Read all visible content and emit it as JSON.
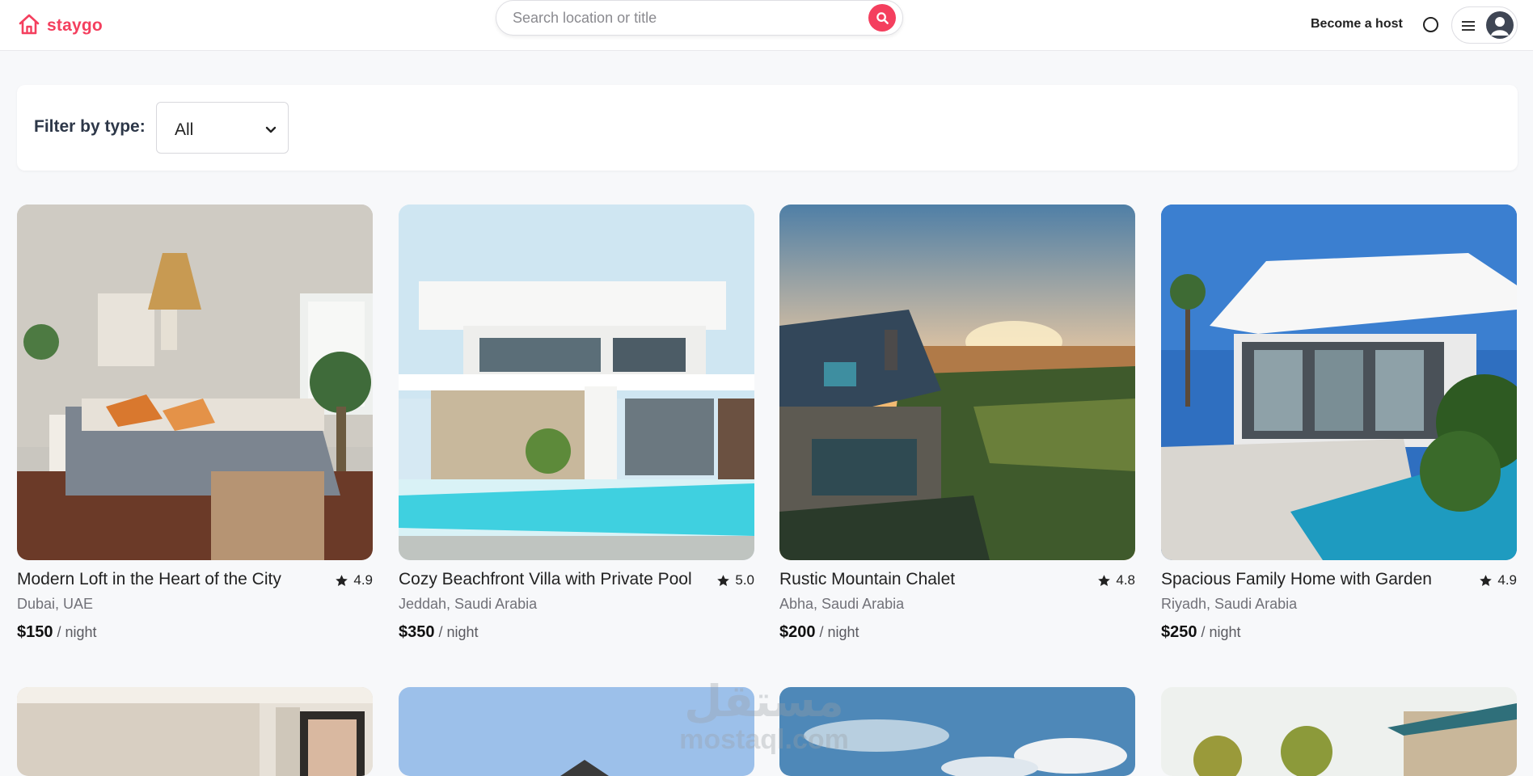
{
  "header": {
    "brand": "staygo",
    "search_placeholder": "Search location or title",
    "host_link": "Become a host"
  },
  "colors": {
    "accent": "#f43f5e",
    "background": "#f7f8fa",
    "text": "#222222"
  },
  "filter": {
    "label": "Filter by type:",
    "selected": "All"
  },
  "listings": [
    {
      "title": "Modern Loft in the Heart of the City",
      "rating": "4.9",
      "location": "Dubai, UAE",
      "price": "$150",
      "unit": "/ night",
      "image": "bedroom-interior"
    },
    {
      "title": "Cozy Beachfront Villa with Private Pool",
      "rating": "5.0",
      "location": "Jeddah, Saudi Arabia",
      "price": "$350",
      "unit": "/ night",
      "image": "white-villa-pool"
    },
    {
      "title": "Rustic Mountain Chalet",
      "rating": "4.8",
      "location": "Abha, Saudi Arabia",
      "price": "$200",
      "unit": "/ night",
      "image": "coastal-house-sunset"
    },
    {
      "title": "Spacious Family Home with Garden",
      "rating": "4.9",
      "location": "Riyadh, Saudi Arabia",
      "price": "$250",
      "unit": "/ night",
      "image": "modern-home-pool"
    }
  ],
  "watermark": {
    "arabic": "مستقل",
    "latin": "mostaql.com"
  }
}
